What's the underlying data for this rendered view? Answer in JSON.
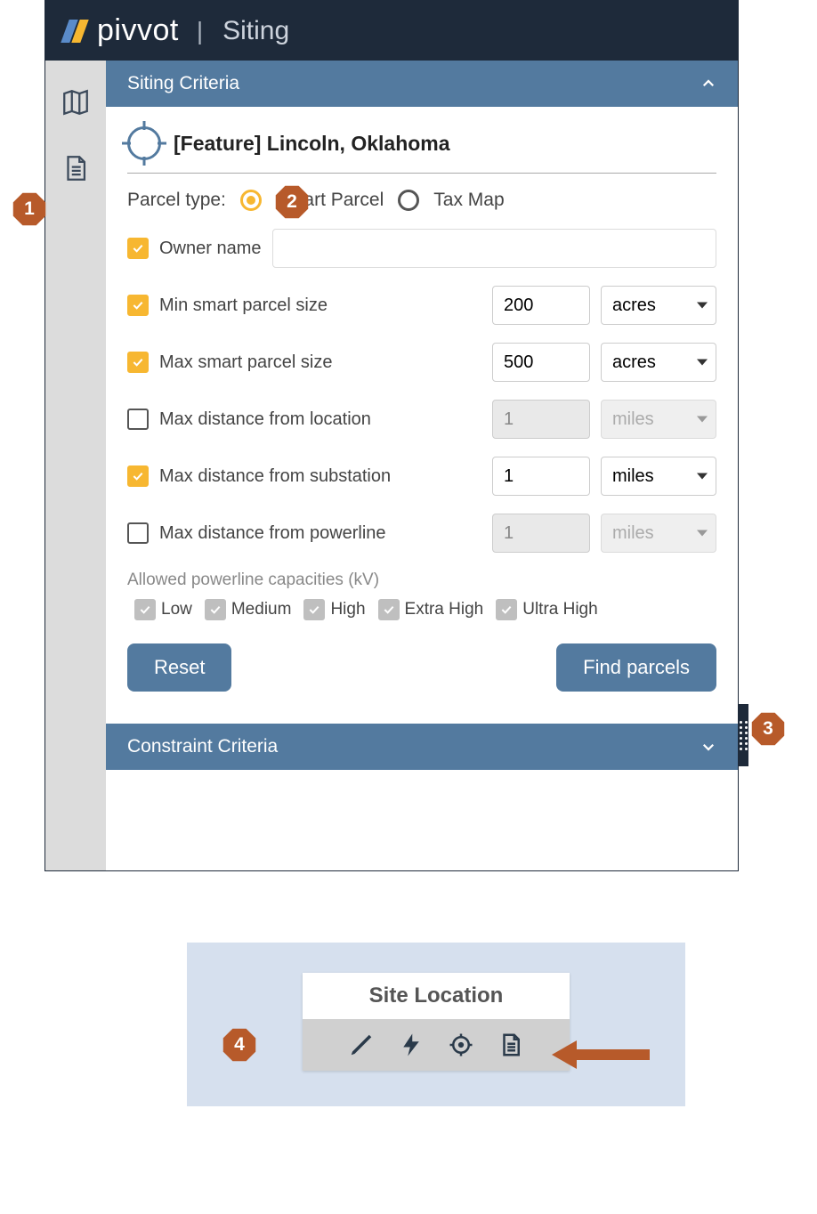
{
  "header": {
    "brand": "pivvot",
    "section": "Siting"
  },
  "callouts": {
    "one": "1",
    "two": "2",
    "three": "3",
    "four": "4"
  },
  "panel": {
    "siting_title": "Siting Criteria",
    "feature_title": "[Feature] Lincoln, Oklahoma",
    "parcel_type_label": "Parcel type:",
    "parcel_options": {
      "smart": "Smart Parcel",
      "tax": "Tax Map"
    },
    "criteria": {
      "owner": {
        "label": "Owner name",
        "value": ""
      },
      "min_size": {
        "label": "Min smart parcel size",
        "value": "200",
        "unit": "acres"
      },
      "max_size": {
        "label": "Max smart parcel size",
        "value": "500",
        "unit": "acres"
      },
      "dist_location": {
        "label": "Max distance from location",
        "value": "1",
        "unit": "miles"
      },
      "dist_sub": {
        "label": "Max distance from substation",
        "value": "1",
        "unit": "miles"
      },
      "dist_power": {
        "label": "Max distance from powerline",
        "value": "1",
        "unit": "miles"
      }
    },
    "capacities_label": "Allowed powerline capacities (kV)",
    "capacities": {
      "low": "Low",
      "medium": "Medium",
      "high": "High",
      "extra": "Extra High",
      "ultra": "Ultra High"
    },
    "reset_label": "Reset",
    "find_label": "Find parcels",
    "constraint_title": "Constraint Criteria"
  },
  "toolbar_card": {
    "title": "Site Location"
  }
}
